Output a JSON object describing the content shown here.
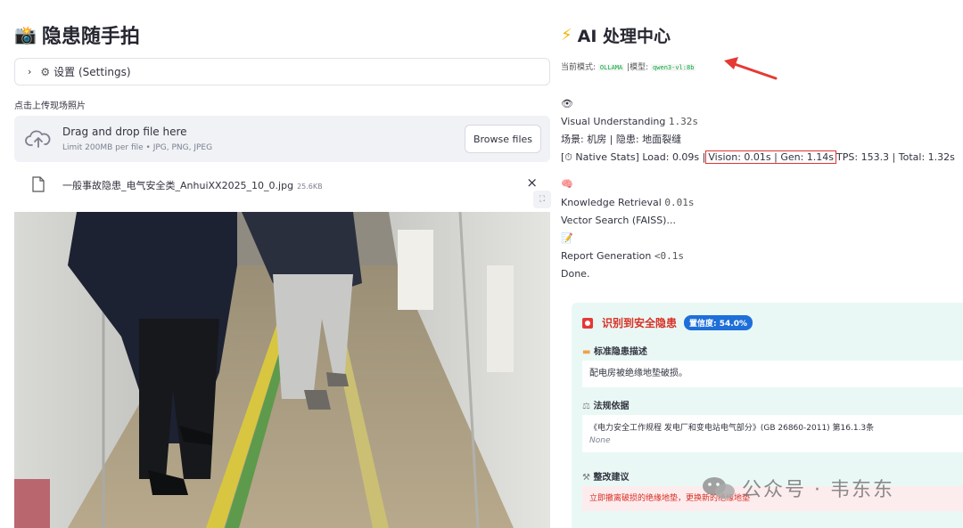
{
  "left": {
    "title_emoji": "📸",
    "title": "隐患随手拍",
    "settings_label": "设置 (Settings)",
    "upload_label": "点击上传现场照片",
    "dropzone": {
      "title": "Drag and drop file here",
      "subtitle": "Limit 200MB per file • JPG, PNG, JPEG",
      "browse_label": "Browse files"
    },
    "file": {
      "name": "一般事故隐患_电气安全类_AnhuiXX2025_10_0.jpg",
      "size": "25.6KB",
      "close_glyph": "×"
    }
  },
  "right": {
    "title_emoji": "⚡",
    "title": "AI 处理中心",
    "mode_prefix": "当前模式:",
    "mode_value": "OLLAMA",
    "model_prefix": "|模型:",
    "model_value": "qwen3-vl:8b",
    "log": {
      "eye_emoji": "👁",
      "vis_label": "Visual Understanding",
      "vis_time": "1.32s",
      "scene": "场景: 机房 | 隐患: 地面裂缝",
      "stats_prefix": "[⏱ Native Stats] Load: 0.09s |",
      "stats_highlight": "Vision: 0.01s | Gen: 1.14s",
      "stats_suffix": "TPS: 153.3 | Total: 1.32s",
      "brain_emoji": "🧠",
      "kr_label": "Knowledge Retrieval",
      "kr_time": "0.01s",
      "vector": "Vector Search (FAISS)...",
      "memo_emoji": "📝",
      "rg_label": "Report Generation",
      "rg_time": "<0.1s",
      "done": "Done."
    },
    "result": {
      "title": "识别到安全隐患",
      "confidence": "置信度: 54.0%",
      "desc_label": "标准隐患描述",
      "desc_text": "配电房被绝缘地垫破损。",
      "law_label": "法规依据",
      "law_text": "《电力安全工作规程 发电厂和变电站电气部分》(GB 26860-2011) 第16.1.3条",
      "law_none": "None",
      "fix_label": "整改建议",
      "fix_text": "立即撤离破损的绝缘地垫，更换新的绝缘地垫"
    }
  },
  "watermark": "公众号 · 韦东东",
  "colors": {
    "accent_red": "#d93025",
    "badge_blue": "#1e6fd9",
    "card_bg": "#e9f8f5",
    "code_green": "#09ab3b"
  }
}
